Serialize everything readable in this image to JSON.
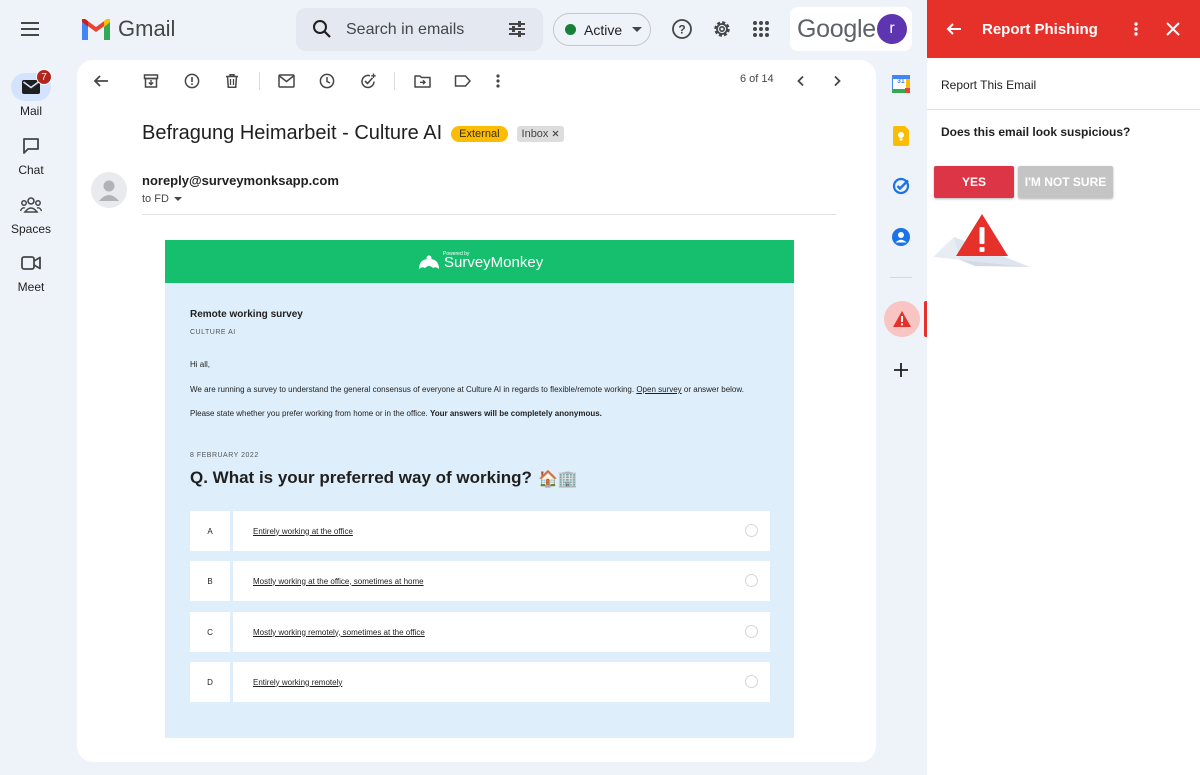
{
  "topbar": {
    "app_name": "Gmail",
    "search_placeholder": "Search in emails",
    "status_label": "Active",
    "account_brand": "Google",
    "avatar_initial": "r"
  },
  "leftnav": {
    "items": [
      {
        "label": "Mail",
        "icon": "mail-icon",
        "badge": "7",
        "active": true
      },
      {
        "label": "Chat",
        "icon": "chat-icon"
      },
      {
        "label": "Spaces",
        "icon": "spaces-icon"
      },
      {
        "label": "Meet",
        "icon": "meet-icon"
      }
    ]
  },
  "mail": {
    "pager": "6 of 14",
    "subject": "Befragung Heimarbeit - Culture AI",
    "labels": {
      "external": "External",
      "inbox": "Inbox"
    },
    "sender": "noreply@surveymonksapp.com",
    "to": "to FD"
  },
  "email_body": {
    "powered_by": "Powered by",
    "brand": "SurveyMonkey",
    "survey_title": "Remote working survey",
    "org": "CULTURE AI",
    "greeting": "Hi all,",
    "line1_pre": "We are running a survey to understand the general consensus of everyone at Culture AI in regards to flexible/remote working. ",
    "line1_link": "Open survey",
    "line1_post": " or answer below.",
    "line2_pre": "Please state whether you prefer working from home or in the office. ",
    "line2_bold": "Your answers will be completely anonymous.",
    "date": "8 FEBRUARY 2022",
    "question": "Q. What is your preferred way of working?",
    "question_emoji": "🏠🏢",
    "options": [
      {
        "letter": "A",
        "text": "Entirely working at the office"
      },
      {
        "letter": "B",
        "text": "Mostly working at the office, sometimes at home"
      },
      {
        "letter": "C",
        "text": "Mostly working remotely, sometimes at the office"
      },
      {
        "letter": "D",
        "text": "Entirely working remotely"
      }
    ]
  },
  "strip": {
    "calendar_day": "31"
  },
  "panel": {
    "title": "Report Phishing",
    "subtitle": "Report This Email",
    "question": "Does this email look suspicious?",
    "yes_label": "YES",
    "not_sure_label": "I'M NOT SURE"
  },
  "colors": {
    "panel_red": "#e6302a",
    "yes_red": "#dc3545",
    "survey_green": "#15bf6e",
    "external_yellow": "#fbbc04",
    "avatar_purple": "#5e35b1"
  }
}
